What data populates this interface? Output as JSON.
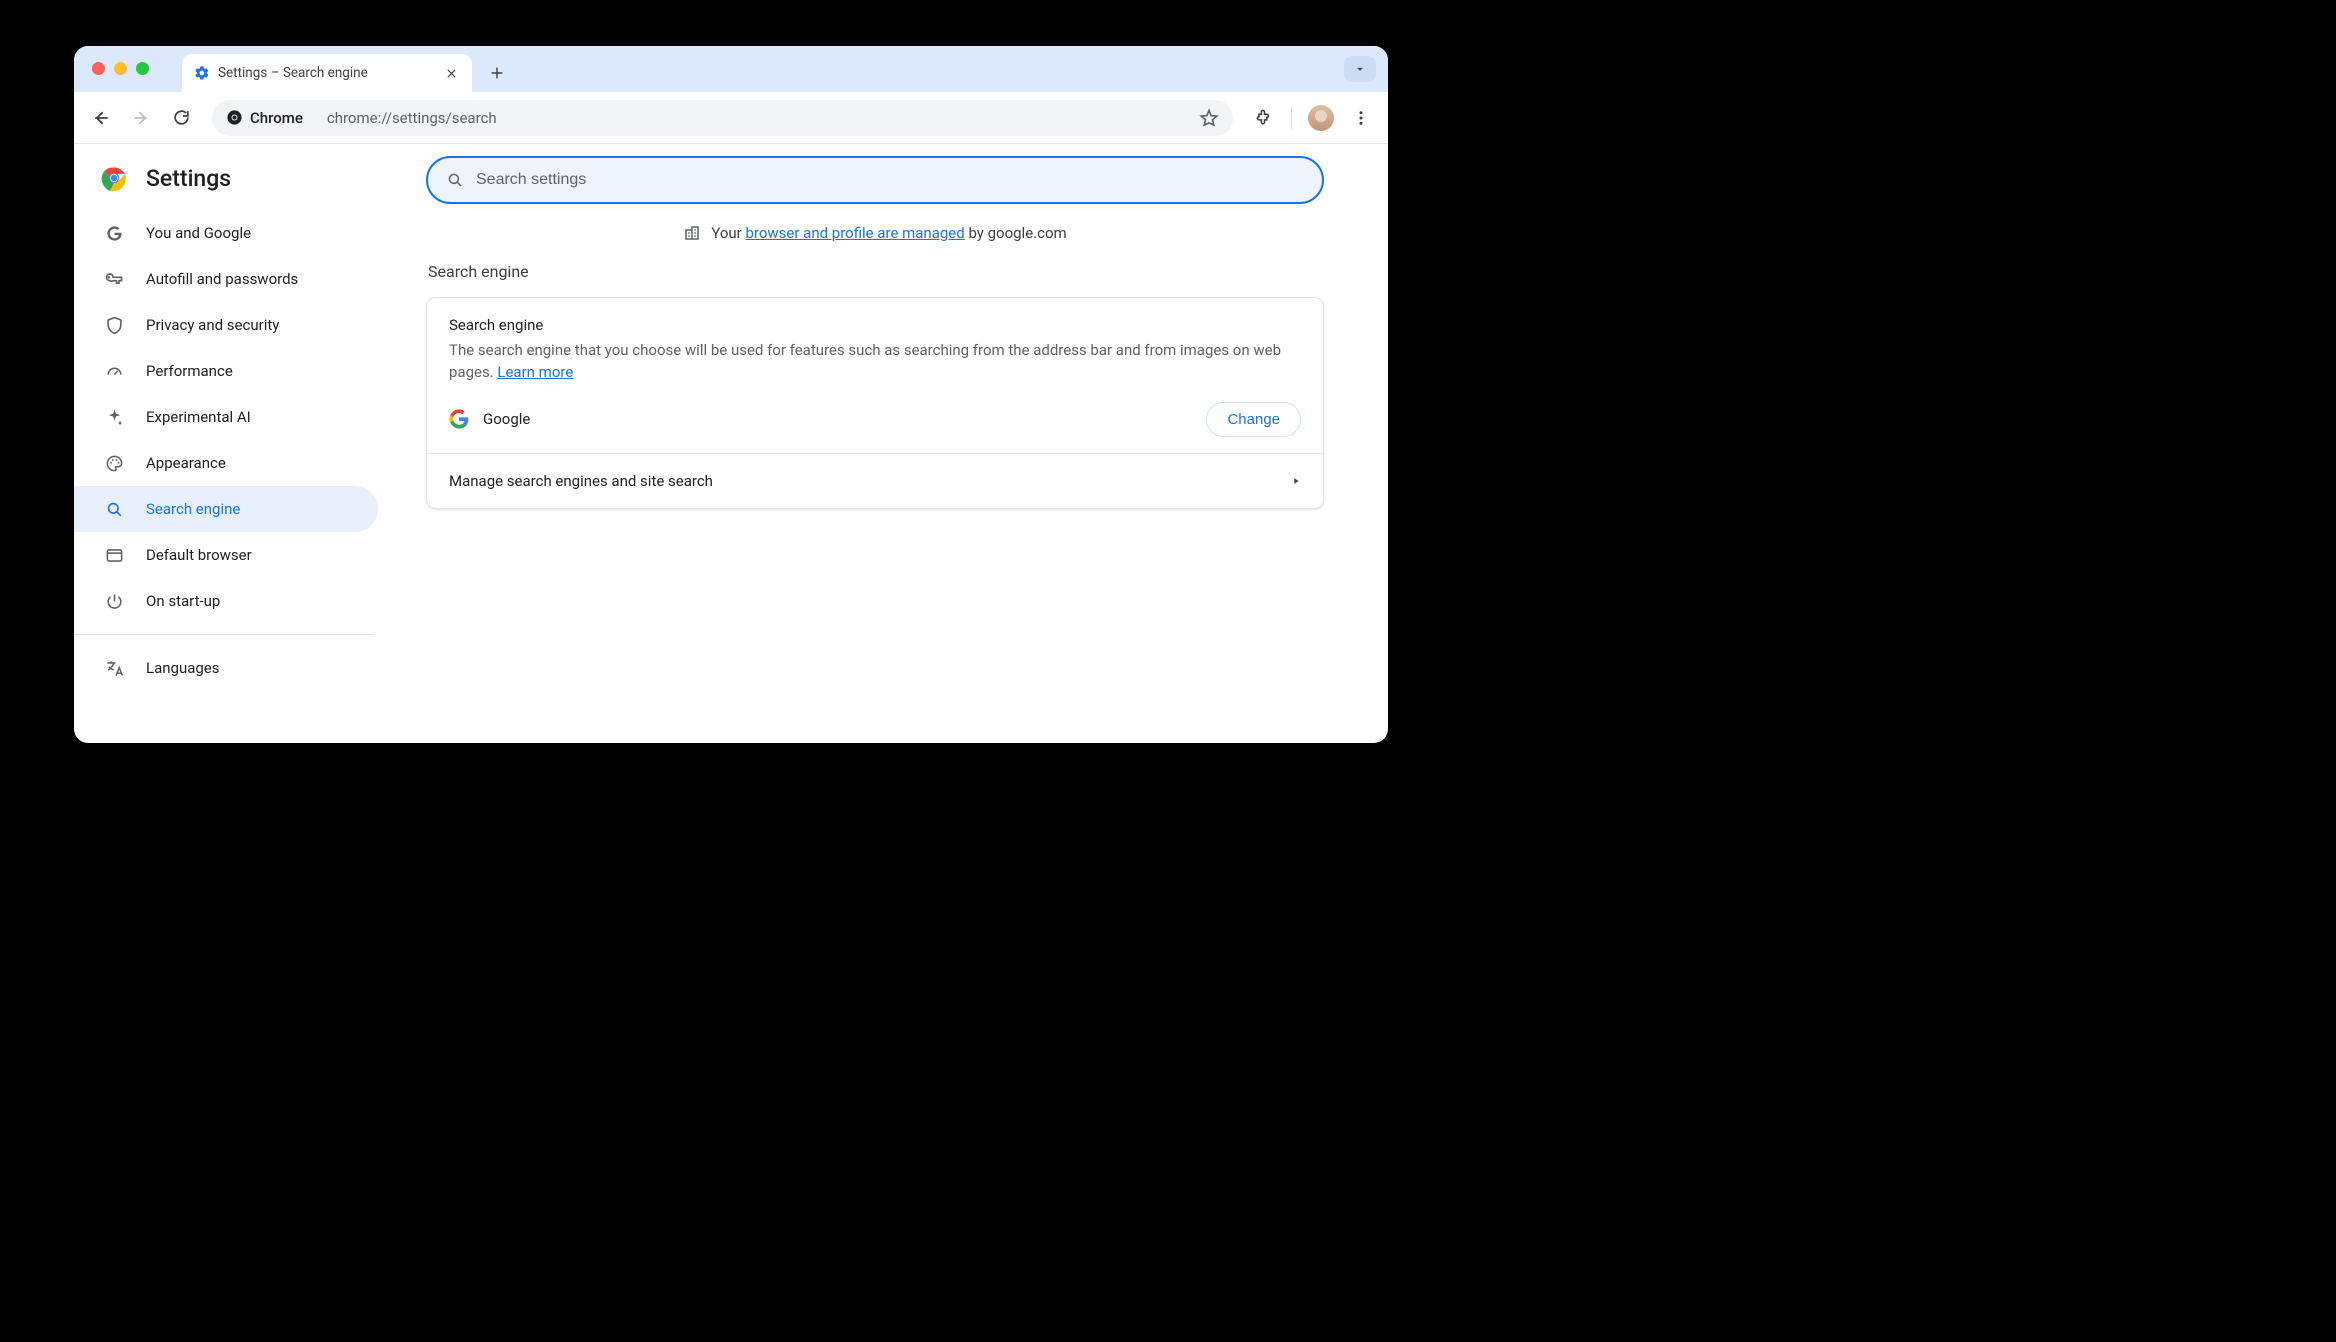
{
  "window": {
    "tab_title": "Settings – Search engine"
  },
  "toolbar": {
    "chip_label": "Chrome",
    "url": "chrome://settings/search"
  },
  "sidebar": {
    "title": "Settings",
    "items": [
      {
        "label": "You and Google"
      },
      {
        "label": "Autofill and passwords"
      },
      {
        "label": "Privacy and security"
      },
      {
        "label": "Performance"
      },
      {
        "label": "Experimental AI"
      },
      {
        "label": "Appearance"
      },
      {
        "label": "Search engine"
      },
      {
        "label": "Default browser"
      },
      {
        "label": "On start-up"
      },
      {
        "label": "Languages"
      }
    ]
  },
  "search": {
    "placeholder": "Search settings"
  },
  "managed": {
    "prefix": "Your ",
    "link": "browser and profile are managed",
    "suffix": " by google.com"
  },
  "section": {
    "title": "Search engine"
  },
  "card": {
    "heading": "Search engine",
    "desc": "The search engine that you choose will be used for features such as searching from the address bar and from images on web pages. ",
    "learn_more": "Learn more",
    "engine": "Google",
    "change": "Change",
    "manage": "Manage search engines and site search"
  }
}
